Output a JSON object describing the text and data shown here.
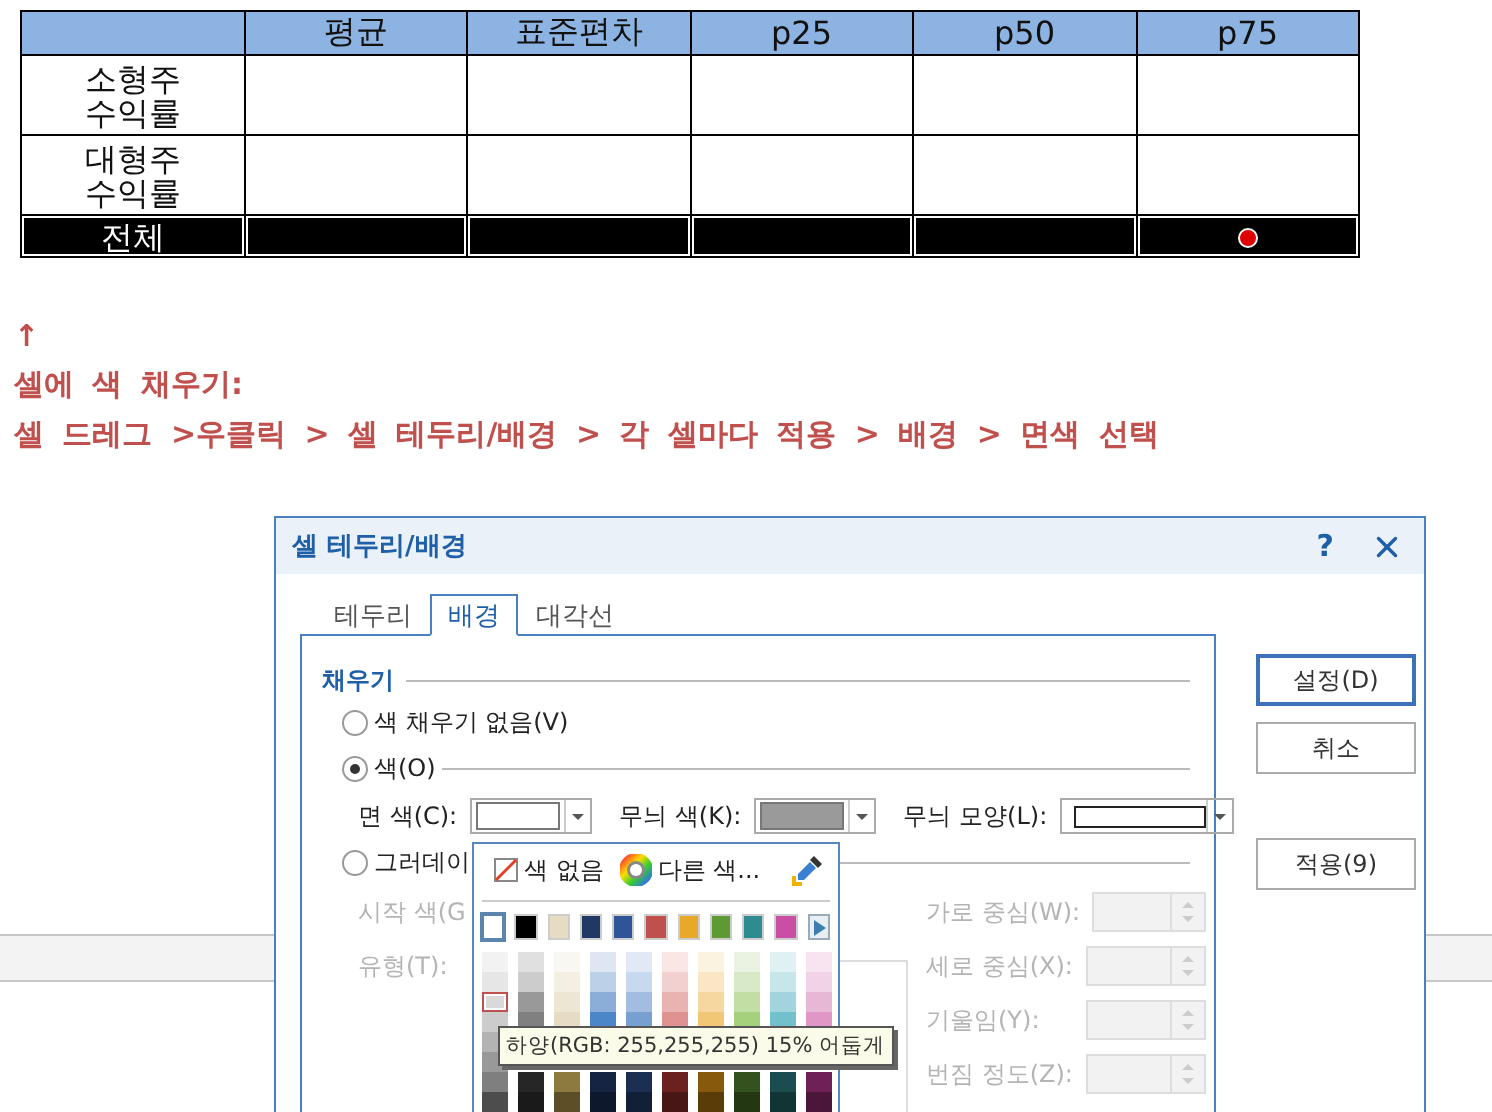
{
  "table": {
    "columns": [
      "평균",
      "표준편차",
      "p25",
      "p50",
      "p75"
    ],
    "rows": [
      {
        "label": "소형주\n수익률",
        "kind": "plain"
      },
      {
        "label": "대형주\n수익률",
        "kind": "plain"
      },
      {
        "label": "전체",
        "kind": "filled"
      }
    ]
  },
  "note": {
    "arrow": "↑",
    "title": "셀에 색 채우기:",
    "steps": "셀 드레그 >우클릭 > 셀 테두리/배경 > 각 셀마다 적용 > 배경 > 면색 선택"
  },
  "dialog": {
    "title": "셀 테두리/배경",
    "help": "?",
    "tabs": [
      {
        "label": "테두리",
        "selected": false
      },
      {
        "label": "배경",
        "selected": true
      },
      {
        "label": "대각선",
        "selected": false
      }
    ],
    "buttons": [
      {
        "label": "설정(D)",
        "default": true
      },
      {
        "label": "취소",
        "default": false
      },
      {
        "label": "적용(9)",
        "default": false
      }
    ],
    "section": "채우기",
    "radios": [
      {
        "label": "색 채우기 없음(V)",
        "selected": false
      },
      {
        "label": "색(O)",
        "selected": true
      },
      {
        "label": "그러데이",
        "selected": false
      }
    ],
    "color_fields": [
      {
        "label": "면 색(C):",
        "kind": "color",
        "color": "#ffffff"
      },
      {
        "label": "무늬 색(K):",
        "kind": "color",
        "color": "#9a9a9a"
      },
      {
        "label": "무늬 모양(L):",
        "kind": "pattern"
      }
    ],
    "gradient_left": [
      {
        "label": "시작 색(G",
        "disabled": true
      },
      {
        "label": "유형(T):",
        "disabled": true
      }
    ],
    "gradient_right": [
      {
        "label": "가로 중심(W):",
        "disabled": true
      },
      {
        "label": "세로 중심(X):",
        "disabled": true
      },
      {
        "label": "기울임(Y):",
        "disabled": true
      },
      {
        "label": "번짐 정도(Z):",
        "disabled": true
      }
    ]
  },
  "picker": {
    "no_color": "색 없음",
    "more_colors": "다른 색...",
    "swatches": [
      {
        "color": "#ffffff",
        "selected": true
      },
      {
        "color": "#000000",
        "selected": false
      },
      {
        "color": "#e5dcc3",
        "selected": false
      },
      {
        "color": "#1f3864",
        "selected": false
      },
      {
        "color": "#2e5597",
        "selected": false
      },
      {
        "color": "#c0504d",
        "selected": false
      },
      {
        "color": "#e8a82a",
        "selected": false
      },
      {
        "color": "#5e9a34",
        "selected": false
      },
      {
        "color": "#2e8b8f",
        "selected": false
      },
      {
        "color": "#c94ea4",
        "selected": false
      }
    ],
    "shades": [
      {
        "upper": [
          {
            "color": "#f2f2f2",
            "selected": false
          },
          {
            "color": "#e6e6e6",
            "selected": false
          },
          {
            "color": "#d9d9d9",
            "selected": true
          },
          {
            "color": "#cccccc",
            "selected": false
          }
        ],
        "lower": [
          {
            "color": "#b3b3b3",
            "selected": false
          },
          {
            "color": "#999999",
            "selected": false
          },
          {
            "color": "#7f7f7f",
            "selected": false
          },
          {
            "color": "#4d4d4d",
            "selected": false
          }
        ]
      },
      {
        "upper": [
          {
            "color": "#e0e0e0",
            "selected": false
          },
          {
            "color": "#cccccc",
            "selected": false
          },
          {
            "color": "#999999",
            "selected": false
          },
          {
            "color": "#808080",
            "selected": false
          }
        ],
        "lower": [
          {
            "color": "#262626",
            "selected": false
          },
          {
            "color": "#1a1a1a",
            "selected": false
          }
        ]
      },
      {
        "upper": [
          {
            "color": "#f9f7f1",
            "selected": false
          },
          {
            "color": "#f3efe3",
            "selected": false
          },
          {
            "color": "#ede6d3",
            "selected": false
          },
          {
            "color": "#e5dcc3",
            "selected": false
          }
        ],
        "lower": [
          {
            "color": "#8c7a3f",
            "selected": false
          },
          {
            "color": "#5c4f28",
            "selected": false
          }
        ]
      },
      {
        "upper": [
          {
            "color": "#dde6f2",
            "selected": false
          },
          {
            "color": "#bcd0e8",
            "selected": false
          },
          {
            "color": "#8aaed8",
            "selected": false
          },
          {
            "color": "#4a86c8",
            "selected": false
          }
        ],
        "lower": [
          {
            "color": "#142442",
            "selected": false
          },
          {
            "color": "#0d182c",
            "selected": false
          }
        ]
      },
      {
        "upper": [
          {
            "color": "#e0e9f5",
            "selected": false
          },
          {
            "color": "#c8d8ee",
            "selected": false
          },
          {
            "color": "#a3bde2",
            "selected": false
          },
          {
            "color": "#789fd2",
            "selected": false
          }
        ],
        "lower": [
          {
            "color": "#1a2f52",
            "selected": false
          },
          {
            "color": "#111f37",
            "selected": false
          }
        ]
      },
      {
        "upper": [
          {
            "color": "#f9e6e5",
            "selected": false
          },
          {
            "color": "#f2d0cf",
            "selected": false
          },
          {
            "color": "#e8b3b1",
            "selected": false
          },
          {
            "color": "#de9390",
            "selected": false
          }
        ],
        "lower": [
          {
            "color": "#6b2120",
            "selected": false
          },
          {
            "color": "#481614",
            "selected": false
          }
        ]
      },
      {
        "upper": [
          {
            "color": "#fcf2e0",
            "selected": false
          },
          {
            "color": "#fae6c5",
            "selected": false
          },
          {
            "color": "#f5d79f",
            "selected": false
          },
          {
            "color": "#f1c674",
            "selected": false
          }
        ],
        "lower": [
          {
            "color": "#86590d",
            "selected": false
          },
          {
            "color": "#5a3c08",
            "selected": false
          }
        ]
      },
      {
        "upper": [
          {
            "color": "#eaf3e2",
            "selected": false
          },
          {
            "color": "#d7e9c7",
            "selected": false
          },
          {
            "color": "#c2dea4",
            "selected": false
          },
          {
            "color": "#a6d17c",
            "selected": false
          }
        ],
        "lower": [
          {
            "color": "#34521d",
            "selected": false
          },
          {
            "color": "#233713",
            "selected": false
          }
        ]
      },
      {
        "upper": [
          {
            "color": "#e0f1f3",
            "selected": false
          },
          {
            "color": "#c7e6ea",
            "selected": false
          },
          {
            "color": "#a1d4dc",
            "selected": false
          },
          {
            "color": "#72c0cc",
            "selected": false
          }
        ],
        "lower": [
          {
            "color": "#1a4d4f",
            "selected": false
          },
          {
            "color": "#113435",
            "selected": false
          }
        ]
      },
      {
        "upper": [
          {
            "color": "#f7e4f0",
            "selected": false
          },
          {
            "color": "#f1d2e6",
            "selected": false
          },
          {
            "color": "#e7b8d6",
            "selected": false
          },
          {
            "color": "#e196c8",
            "selected": false
          }
        ],
        "lower": [
          {
            "color": "#6f2157",
            "selected": false
          },
          {
            "color": "#4b163a",
            "selected": false
          }
        ]
      }
    ],
    "tooltip": "하양(RGB: 255,255,255) 15% 어둡게"
  }
}
